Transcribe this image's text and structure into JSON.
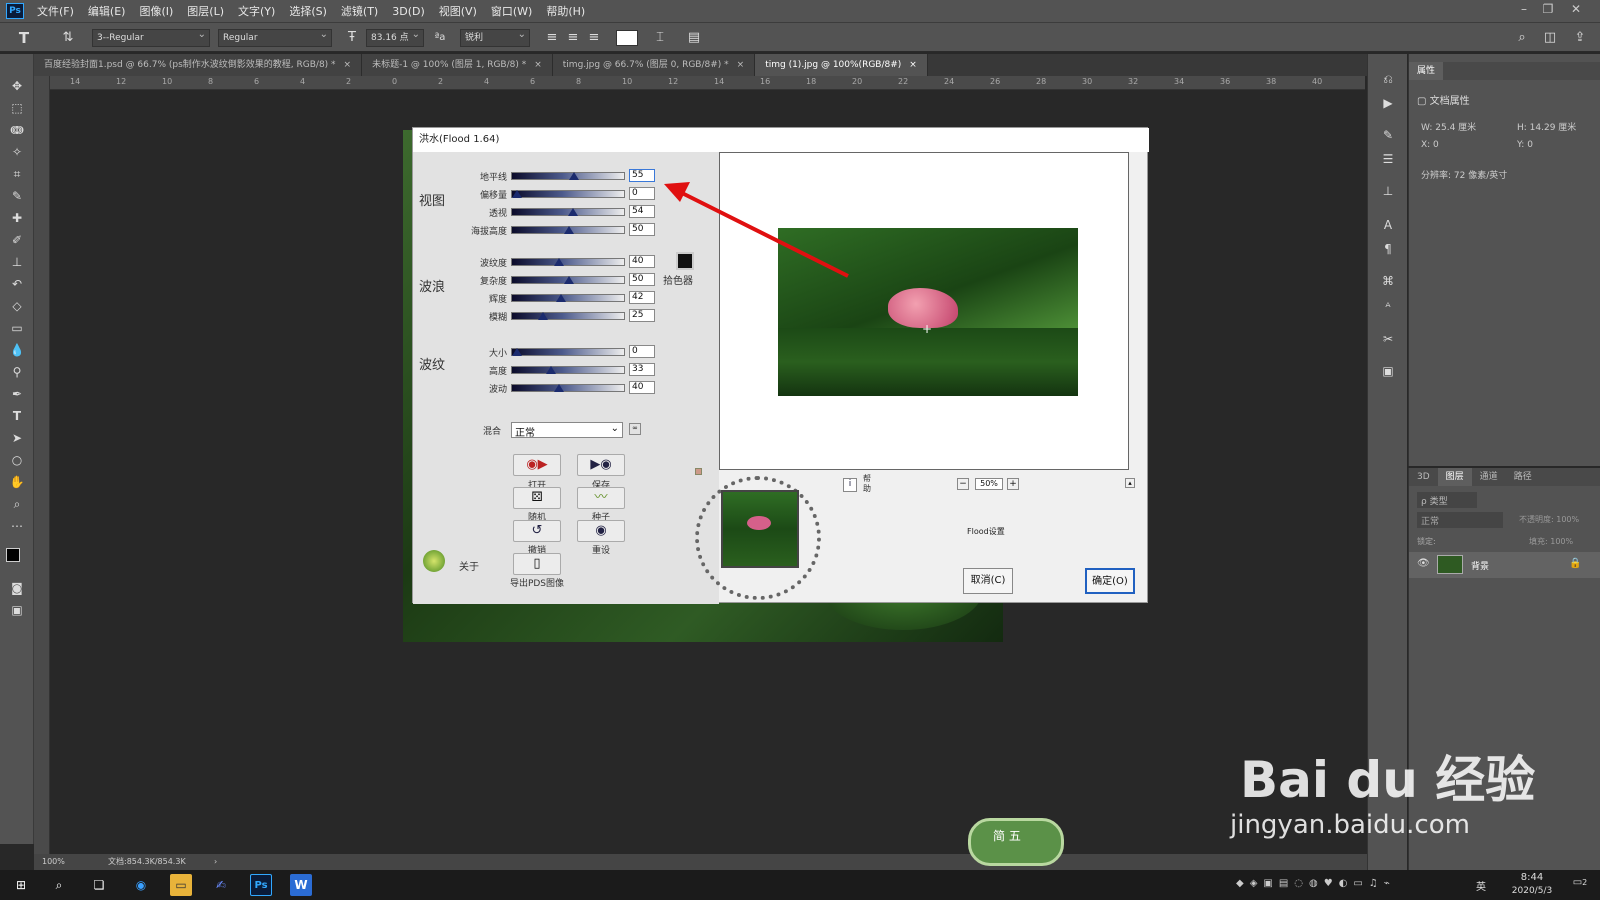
{
  "app": {
    "logo": "Ps"
  },
  "menu": [
    "文件(F)",
    "编辑(E)",
    "图像(I)",
    "图层(L)",
    "文字(Y)",
    "选择(S)",
    "滤镜(T)",
    "3D(D)",
    "视图(V)",
    "窗口(W)",
    "帮助(H)"
  ],
  "options": {
    "font_family": "3--Regular",
    "font_style": "Regular",
    "font_size": "83.16 点",
    "antialias": "锐利"
  },
  "tabs": [
    {
      "label": "百度经验封面1.psd @ 66.7% (ps制作水波纹倒影效果的教程, RGB/8) *",
      "close": "×"
    },
    {
      "label": "未标题-1 @ 100% (图层 1, RGB/8) *",
      "close": "×"
    },
    {
      "label": "timg.jpg @ 66.7% (图层 0, RGB/8#) *",
      "close": "×"
    },
    {
      "label": "timg (1).jpg @ 100%(RGB/8#)",
      "close": "×"
    }
  ],
  "ruler_ticks": [
    "14",
    "12",
    "10",
    "8",
    "6",
    "4",
    "2",
    "0",
    "2",
    "4",
    "6",
    "8",
    "10",
    "12",
    "14",
    "16",
    "18",
    "20",
    "22",
    "24",
    "26",
    "28",
    "30",
    "32",
    "34",
    "36",
    "38",
    "40"
  ],
  "status": {
    "zoom": "100%",
    "doc": "文档:854.3K/854.3K",
    "arrow": "›"
  },
  "dialog": {
    "title": "洪水(Flood 1.64)",
    "sections": {
      "view": "视图",
      "waves": "波浪",
      "ripple": "波纹"
    },
    "sliders": [
      {
        "label": "地平线",
        "value": "55",
        "pct": 0.55
      },
      {
        "label": "偏移量",
        "value": "0",
        "pct": 0.0
      },
      {
        "label": "透视",
        "value": "54",
        "pct": 0.54
      },
      {
        "label": "海拔高度",
        "value": "50",
        "pct": 0.5
      },
      {
        "label": "波纹度",
        "value": "40",
        "pct": 0.4
      },
      {
        "label": "复杂度",
        "value": "50",
        "pct": 0.5
      },
      {
        "label": "辉度",
        "value": "42",
        "pct": 0.42
      },
      {
        "label": "模糊",
        "value": "25",
        "pct": 0.25
      },
      {
        "label": "大小",
        "value": "0",
        "pct": 0.0
      },
      {
        "label": "高度",
        "value": "33",
        "pct": 0.33
      },
      {
        "label": "波动",
        "value": "40",
        "pct": 0.4
      }
    ],
    "color_picker": "拾色器",
    "blend_label": "混合",
    "blend_value": "正常",
    "buttons": {
      "open": "打开",
      "save": "保存",
      "random": "随机",
      "seed": "种子",
      "undo": "撤销",
      "reset": "重设",
      "export": "导出PDS图像",
      "about": "关于"
    },
    "help": "帮助",
    "zoom": "50%",
    "zoom_minus": "−",
    "zoom_plus": "+",
    "settings": "Flood设置",
    "cancel": "取消(C)",
    "ok": "确定(O)"
  },
  "properties": {
    "title": "属性",
    "doc_props": "文档属性",
    "w": "W: 25.4 厘米",
    "h": "H: 14.29 厘米",
    "x": "X: 0",
    "y": "Y: 0",
    "resolution": "分辨率: 72 像素/英寸"
  },
  "layers_panel": {
    "tabs": [
      "3D",
      "图层",
      "通道",
      "路径"
    ],
    "kind": "ρ 类型",
    "mode": "正常",
    "opacity": "不透明度: 100%",
    "lock": "锁定:",
    "fill": "填充: 100%",
    "layer_name": "背景"
  },
  "taskbar": {
    "time": "8:44",
    "date": "2020/5/3",
    "ime": "英",
    "notify": "2"
  },
  "watermark": {
    "main": "Bai du 经验",
    "url": "jingyan.baidu.com",
    "badge": "简 五"
  },
  "colors": {
    "ps_bg": "#535353",
    "canvas": "#282828",
    "arrow": "#e01010",
    "dialog_bg": "#f0f0f0"
  }
}
